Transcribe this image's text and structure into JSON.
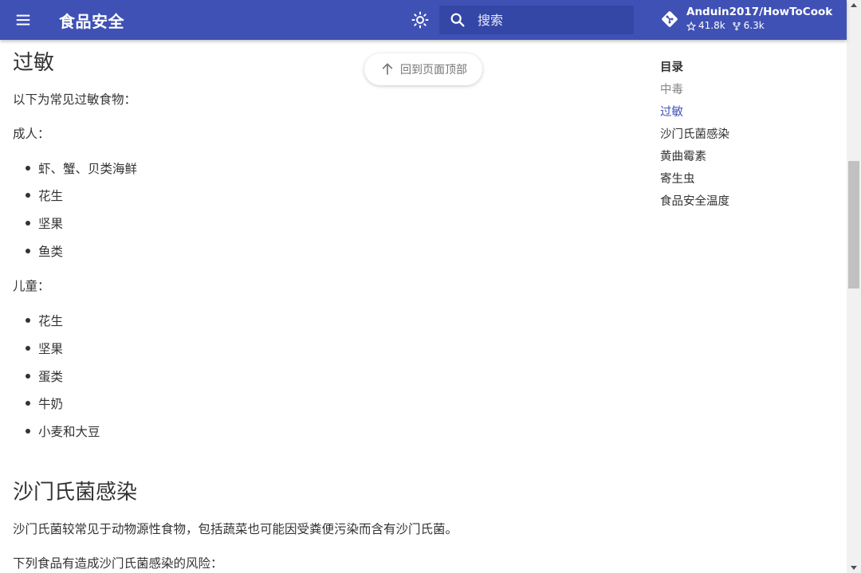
{
  "header": {
    "title": "食品安全",
    "search_placeholder": "搜索",
    "repo": {
      "name": "Anduin2017/HowToCook",
      "stars": "41.8k",
      "forks": "6.3k"
    }
  },
  "back_to_top": "回到页面顶部",
  "content": {
    "allergy": {
      "heading": "过敏",
      "intro": "以下为常见过敏食物：",
      "adults_label": "成人：",
      "adults_items": [
        "虾、蟹、贝类海鲜",
        "花生",
        "坚果",
        "鱼类"
      ],
      "children_label": "儿童：",
      "children_items": [
        "花生",
        "坚果",
        "蛋类",
        "牛奶",
        "小麦和大豆"
      ]
    },
    "salmonella": {
      "heading": "沙门氏菌感染",
      "para1": "沙门氏菌较常见于动物源性食物，包括蔬菜也可能因受粪便污染而含有沙门氏菌。",
      "para2": "下列食品有造成沙门氏菌感染的风险："
    }
  },
  "toc": {
    "title": "目录",
    "items": [
      "中毒",
      "过敏",
      "沙门氏菌感染",
      "黄曲霉素",
      "寄生虫",
      "食品安全温度"
    ]
  },
  "colors": {
    "primary": "#4051b5",
    "search_bg": "#3446a6",
    "text": "#333333"
  }
}
